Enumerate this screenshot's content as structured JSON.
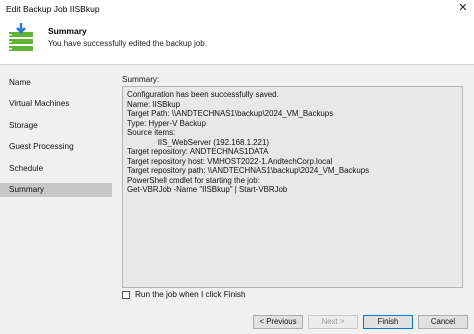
{
  "window": {
    "title": "Edit Backup Job IISBkup",
    "close_glyph": "✕"
  },
  "header": {
    "title": "Summary",
    "subtitle": "You have successfully edited the backup job.",
    "icon": "backup-job-icon"
  },
  "sidebar": {
    "items": [
      {
        "label": "Name",
        "active": false
      },
      {
        "label": "Virtual Machines",
        "active": false
      },
      {
        "label": "Storage",
        "active": false
      },
      {
        "label": "Guest Processing",
        "active": false
      },
      {
        "label": "Schedule",
        "active": false
      },
      {
        "label": "Summary",
        "active": true
      }
    ]
  },
  "main": {
    "summary_label": "Summary:",
    "summary_lines": [
      "Configuration has been successfully saved.",
      "Name: IISBkup",
      "Target Path: \\\\ANDTECHNAS1\\backup\\2024_VM_Backups",
      "Type: Hyper-V Backup",
      "Source items:",
      "              IIS_WebServer (192.168.1.221)",
      "Target repository: ANDTECHNAS1DATA",
      "Target repository host: VMHOST2022-1.AndtechCorp.local",
      "Target repository path: \\\\ANDTECHNAS1\\backup\\2024_VM_Backups",
      "",
      "PowerShell cmdlet for starting the job:",
      "Get-VBRJob -Name \"IISBkup\" | Start-VBRJob"
    ],
    "run_job_label": "Run the job when I click Finish",
    "run_job_checked": false
  },
  "footer": {
    "previous_label": "< Previous",
    "next_label": "Next >",
    "finish_label": "Finish",
    "cancel_label": "Cancel"
  },
  "colors": {
    "panel_bg": "#f0f0f0",
    "selected_item": "#c8c8c8",
    "icon_green": "#5fb336",
    "icon_blue": "#2a7bd1"
  }
}
